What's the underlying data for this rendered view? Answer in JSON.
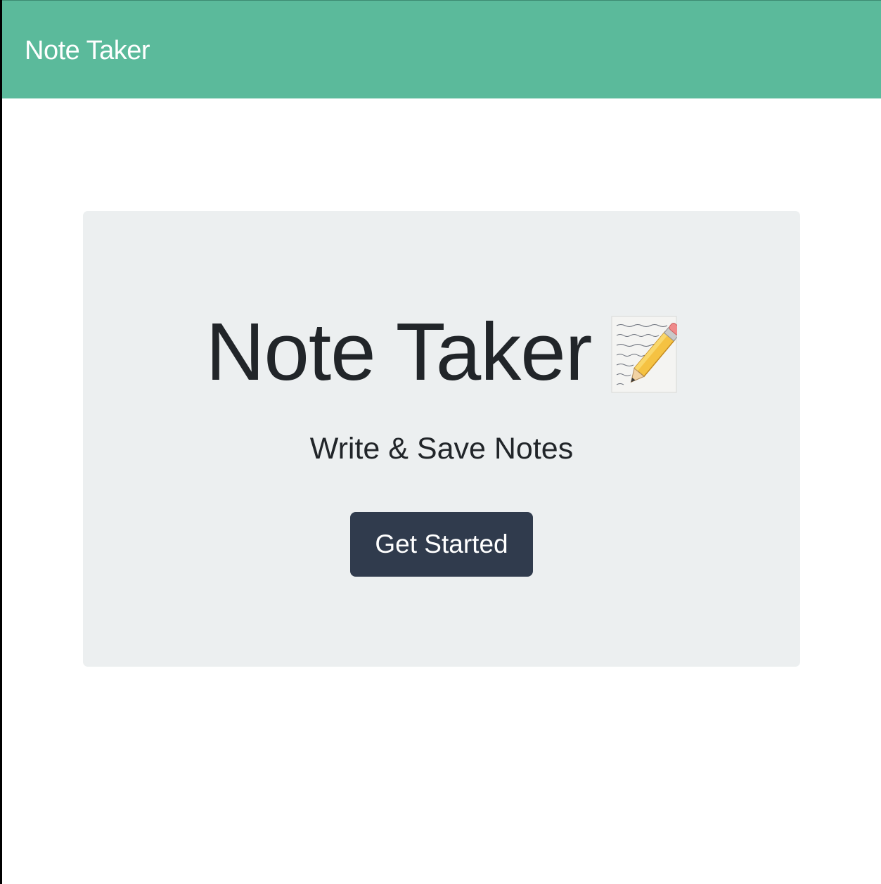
{
  "navbar": {
    "brand": "Note Taker",
    "color": "#5bba9b"
  },
  "jumbotron": {
    "title": "Note Taker",
    "icon": "memo-icon",
    "subtitle": "Write & Save Notes",
    "cta_label": "Get Started",
    "background": "#eceff0"
  },
  "colors": {
    "text": "#212529",
    "button": "#303b4d"
  }
}
